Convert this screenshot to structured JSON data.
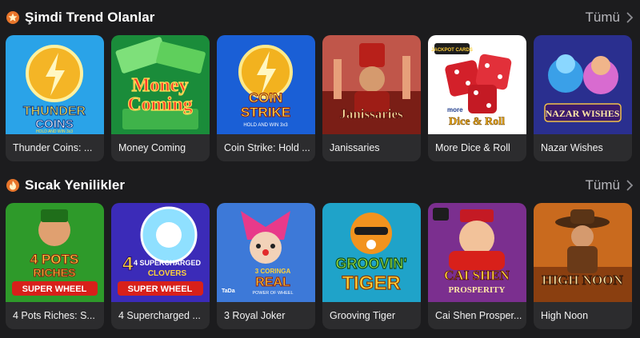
{
  "sections": [
    {
      "title": "Şimdi Trend Olanlar",
      "see_all": "Tümü",
      "icon": "star-badge-icon",
      "games": [
        {
          "name": "Thunder Coins: ...",
          "art": [
            "THUNDER",
            "COINS",
            "HOLD AND WIN 3x3"
          ],
          "bg": "#2aa3e8"
        },
        {
          "name": "Money Coming",
          "art": [
            "Money",
            "Coming"
          ],
          "bg": "#1a8c3a"
        },
        {
          "name": "Coin Strike: Hold ...",
          "art": [
            "COIN",
            "STRIKE",
            "HOLD AND WIN 3x3"
          ],
          "bg": "#1a5fd6"
        },
        {
          "name": "Janissaries",
          "art": [
            "Janissaries"
          ],
          "bg": "#8a2b1e"
        },
        {
          "name": "More Dice & Roll",
          "art": [
            "JACKPOT CARDS",
            "more",
            "Dice & Roll"
          ],
          "bg": "#ffffff"
        },
        {
          "name": "Nazar Wishes",
          "art": [
            "NAZAR WISHES"
          ],
          "bg": "#2a2f8f"
        }
      ]
    },
    {
      "title": "Sıcak Yenilikler",
      "see_all": "Tümü",
      "icon": "flame-badge-icon",
      "games": [
        {
          "name": "4 Pots Riches: S...",
          "art": [
            "4 POTS",
            "RICHES",
            "SUPER WHEEL"
          ],
          "bg": "#2e9a2a"
        },
        {
          "name": "4 Supercharged ...",
          "art": [
            "4 SUPERCHARGED",
            "CLOVERS",
            "SUPER WHEEL"
          ],
          "bg": "#3b2bb8"
        },
        {
          "name": "3 Royal Joker",
          "art": [
            "3 CORINGA",
            "REAL",
            "POWER OF WHEEL",
            "TaDa"
          ],
          "bg": "#3d79d8"
        },
        {
          "name": "Grooving Tiger",
          "art": [
            "GROOVIN'",
            "TIGER"
          ],
          "bg": "#1fa3c9"
        },
        {
          "name": "Cai Shen Prosper...",
          "art": [
            "CAI SHEN",
            "PROSPERITY"
          ],
          "bg": "#7b2f8f"
        },
        {
          "name": "High Noon",
          "art": [
            "HIGH NOON"
          ],
          "bg": "#c96a1e"
        }
      ]
    }
  ]
}
